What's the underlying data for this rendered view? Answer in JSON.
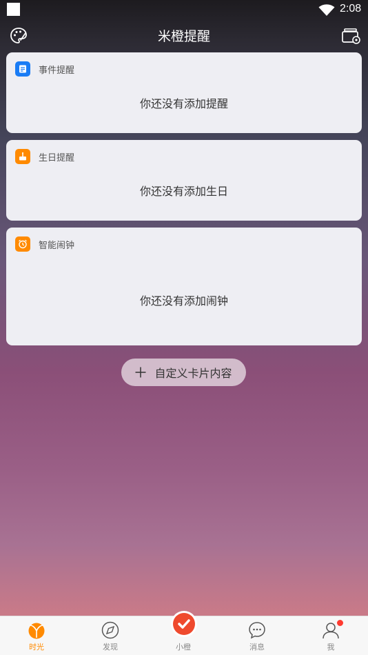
{
  "status_bar": {
    "time": "2:08"
  },
  "header": {
    "title": "米橙提醒",
    "left_icon": "palette-icon",
    "right_icon": "cards-settings-icon"
  },
  "cards": [
    {
      "label": "事件提醒",
      "icon": "event-note-icon",
      "icon_color": "#1a7cf5",
      "empty_text": "你还没有添加提醒"
    },
    {
      "label": "生日提醒",
      "icon": "cake-icon",
      "icon_color": "#ff8a00",
      "empty_text": "你还没有添加生日"
    },
    {
      "label": "智能闹钟",
      "icon": "alarm-clock-icon",
      "icon_color": "#ff8a00",
      "empty_text": "你还没有添加闹钟"
    }
  ],
  "custom_button": {
    "label": "自定义卡片内容"
  },
  "tabs": [
    {
      "label": "时光",
      "icon": "orange-time-icon",
      "active": true
    },
    {
      "label": "发现",
      "icon": "compass-icon",
      "active": false
    },
    {
      "label": "小橙",
      "icon": "xiaocheng-check-icon",
      "active": false
    },
    {
      "label": "消息",
      "icon": "chat-bubble-icon",
      "active": false
    },
    {
      "label": "我",
      "icon": "person-icon",
      "active": false,
      "has_dot": true
    }
  ],
  "colors": {
    "accent": "#ff8a00",
    "card_bg": "#eeeef3",
    "badge_red": "#ff3b30"
  }
}
